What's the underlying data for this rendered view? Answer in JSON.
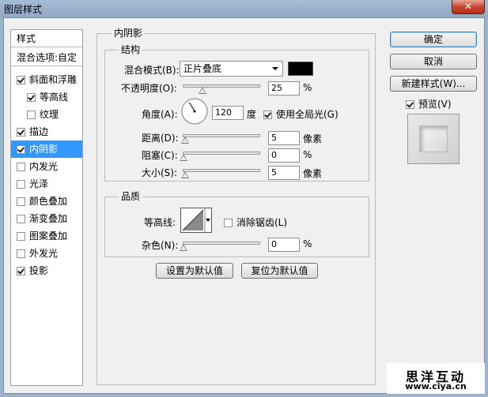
{
  "window": {
    "title": "图层样式",
    "close_glyph": "✕"
  },
  "styles_list": {
    "header": "样式",
    "blend_options": "混合选项:自定",
    "items": [
      {
        "label": "斜面和浮雕",
        "checked": true,
        "indent": false,
        "selected": false
      },
      {
        "label": "等高线",
        "checked": true,
        "indent": true,
        "selected": false
      },
      {
        "label": "纹理",
        "checked": false,
        "indent": true,
        "selected": false
      },
      {
        "label": "描边",
        "checked": true,
        "indent": false,
        "selected": false
      },
      {
        "label": "内阴影",
        "checked": true,
        "indent": false,
        "selected": true
      },
      {
        "label": "内发光",
        "checked": false,
        "indent": false,
        "selected": false
      },
      {
        "label": "光泽",
        "checked": false,
        "indent": false,
        "selected": false
      },
      {
        "label": "颜色叠加",
        "checked": false,
        "indent": false,
        "selected": false
      },
      {
        "label": "渐变叠加",
        "checked": false,
        "indent": false,
        "selected": false
      },
      {
        "label": "图案叠加",
        "checked": false,
        "indent": false,
        "selected": false
      },
      {
        "label": "外发光",
        "checked": false,
        "indent": false,
        "selected": false
      },
      {
        "label": "投影",
        "checked": true,
        "indent": false,
        "selected": false
      }
    ]
  },
  "inner_shadow": {
    "title": "内阴影",
    "structure": {
      "title": "结构",
      "blend_mode_label": "混合模式(B):",
      "blend_mode_value": "正片叠底",
      "shadow_color": "#000000",
      "opacity_label": "不透明度(O):",
      "opacity_value": "25",
      "opacity_fraction": 0.25,
      "opacity_unit": "%",
      "angle_label": "角度(A):",
      "angle_value": "120",
      "angle_degrees": 120,
      "angle_unit": "度",
      "global_light_label": "使用全局光(G)",
      "global_light_checked": true,
      "distance_label": "距离(D):",
      "distance_value": "5",
      "distance_fraction": 0.02,
      "distance_unit": "像素",
      "choke_label": "阻塞(C):",
      "choke_value": "0",
      "choke_fraction": 0,
      "choke_unit": "%",
      "size_label": "大小(S):",
      "size_value": "5",
      "size_fraction": 0.02,
      "size_unit": "像素"
    },
    "quality": {
      "title": "品质",
      "contour_label": "等高线:",
      "antialias_label": "消除锯齿(L)",
      "antialias_checked": false,
      "noise_label": "杂色(N):",
      "noise_value": "0",
      "noise_fraction": 0,
      "noise_unit": "%"
    },
    "make_default_label": "设置为默认值",
    "reset_default_label": "复位为默认值"
  },
  "actions": {
    "ok_label": "确定",
    "cancel_label": "取消",
    "new_style_label": "新建样式(W)...",
    "preview_label": "预览(V)",
    "preview_checked": true
  },
  "watermark": {
    "brand": "思洋互动",
    "url": "www.ciya.cn"
  }
}
